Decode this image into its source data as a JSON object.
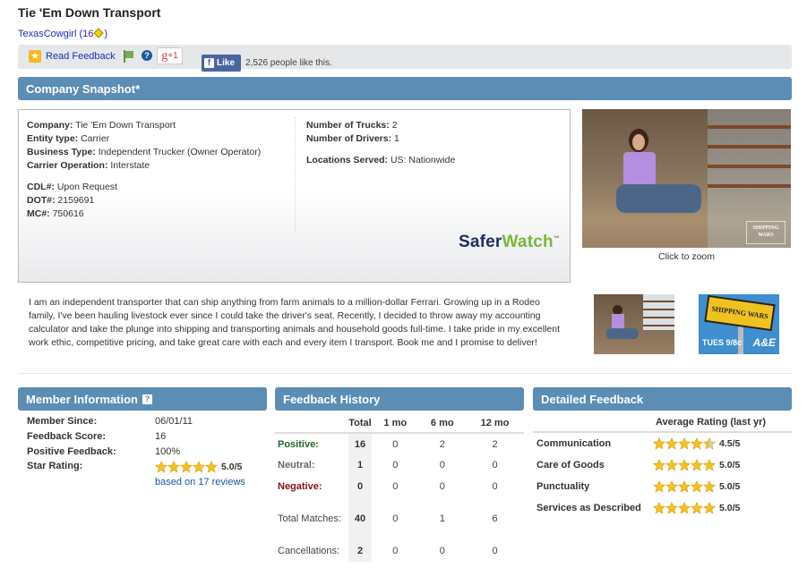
{
  "page": {
    "title": "Tie 'Em Down Transport",
    "user": {
      "name": "TexasCowgirl",
      "score": "16",
      "open": "(",
      "close": ")"
    }
  },
  "toolbar": {
    "read_feedback": "Read Feedback",
    "flag_icon": "flag-icon",
    "help_icon": "help-icon",
    "gplus_label": "+1",
    "gplus_g": "g",
    "fb_like": "Like",
    "fb_count": "2,526 people like this."
  },
  "snapshot": {
    "header": "Company Snapshot*",
    "left": [
      {
        "k": "Company:",
        "v": "Tie 'Em Down Transport"
      },
      {
        "k": "Entity type:",
        "v": "Carrier"
      },
      {
        "k": "Business Type:",
        "v": "Independent Trucker (Owner Operator)"
      },
      {
        "k": "Carrier Operation:",
        "v": "Interstate"
      },
      {
        "k": "CDL#:",
        "v": "Upon Request"
      },
      {
        "k": "DOT#:",
        "v": "2159691"
      },
      {
        "k": "MC#:",
        "v": "750616"
      }
    ],
    "right": [
      {
        "k": "Number of Trucks:",
        "v": "2"
      },
      {
        "k": "Number of Drivers:",
        "v": "1"
      },
      {
        "k": "Locations Served:",
        "v": "US: Nationwide"
      }
    ],
    "logo": {
      "part1": "Safer",
      "part2": "Watch",
      "tm": "™"
    },
    "photo_caption": "Click to zoom",
    "photo_logo": "SHIPPING WARS"
  },
  "bio": "I am an independent transporter that can ship anything from farm animals to a million-dollar Ferrari. Growing up in a Rodeo family, I've been hauling livestock ever since I could take the driver's seat. Recently, I decided to throw away my accounting calculator and take the plunge into shipping and transporting animals and household goods full-time. I take pride in my excellent work ethic, competitive pricing, and take great care with each and every item I transport. Book me and I promise to deliver!",
  "thumbs": {
    "promo_sign": "SHIPPING WARS",
    "promo_time": "TUES 9/8c",
    "promo_network": "A&E"
  },
  "member": {
    "header": "Member Information",
    "help": "?",
    "rows": [
      {
        "k": "Member Since:",
        "v": "06/01/11"
      },
      {
        "k": "Feedback Score:",
        "v": "16"
      },
      {
        "k": "Positive Feedback:",
        "v": "100%"
      },
      {
        "k": "Star Rating:",
        "v": ""
      }
    ],
    "star_rating": 5.0,
    "star_rating_text": "5.0/5",
    "reviews_link": "based on 17 reviews"
  },
  "history": {
    "header": "Feedback History",
    "columns": [
      "",
      "Total",
      "1 mo",
      "6 mo",
      "12 mo"
    ],
    "rows": [
      {
        "label": "Positive:",
        "cls": "pos",
        "values": [
          "16",
          "0",
          "2",
          "2"
        ]
      },
      {
        "label": "Neutral:",
        "cls": "neu",
        "values": [
          "1",
          "0",
          "0",
          "0"
        ]
      },
      {
        "label": "Negative:",
        "cls": "neg",
        "values": [
          "0",
          "0",
          "0",
          "0"
        ]
      },
      {
        "label": "Total Matches:",
        "cls": "tall",
        "values": [
          "40",
          "0",
          "1",
          "6"
        ]
      },
      {
        "label": "Cancellations:",
        "cls": "",
        "values": [
          "2",
          "0",
          "0",
          "0"
        ]
      }
    ]
  },
  "detailed": {
    "header": "Detailed Feedback",
    "col_header": "Average Rating (last yr)",
    "rows": [
      {
        "label": "Communication",
        "rating": 4.5,
        "text": "4.5/5"
      },
      {
        "label": "Care of Goods",
        "rating": 5.0,
        "text": "5.0/5"
      },
      {
        "label": "Punctuality",
        "rating": 5.0,
        "text": "5.0/5"
      },
      {
        "label": "Services as Described",
        "rating": 5.0,
        "text": "5.0/5"
      }
    ]
  },
  "colors": {
    "header_bg": "#5b8db5",
    "link": "#1a2fb0",
    "positive": "#1a6b22",
    "negative": "#8a1010",
    "star": "#f5c21e"
  }
}
